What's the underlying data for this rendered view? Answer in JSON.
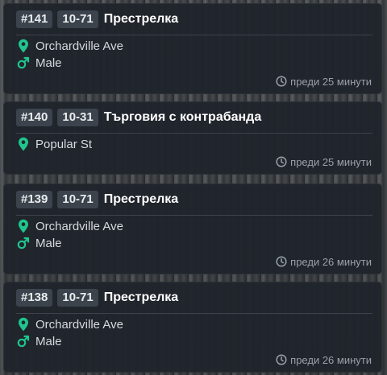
{
  "accent_color": "#1fc58c",
  "calls": [
    {
      "id": "#141",
      "code": "10-71",
      "title": "Престрелка",
      "street": "Orchardville Ave",
      "gender": "Male",
      "time": "преди 25 минути",
      "icons": [
        "map-pin-icon",
        "male-icon",
        "clock-icon"
      ]
    },
    {
      "id": "#140",
      "code": "10-31",
      "title": "Търговия с контрабанда",
      "street": "Popular St",
      "time": "преди 25 минути",
      "icons": [
        "map-pin-icon",
        "clock-icon"
      ]
    },
    {
      "id": "#139",
      "code": "10-71",
      "title": "Престрелка",
      "street": "Orchardville Ave",
      "gender": "Male",
      "time": "преди 26 минути",
      "icons": [
        "map-pin-icon",
        "male-icon",
        "clock-icon"
      ]
    },
    {
      "id": "#138",
      "code": "10-71",
      "title": "Престрелка",
      "street": "Orchardville Ave",
      "gender": "Male",
      "time": "преди 26 минути",
      "icons": [
        "map-pin-icon",
        "male-icon",
        "clock-icon"
      ]
    }
  ]
}
